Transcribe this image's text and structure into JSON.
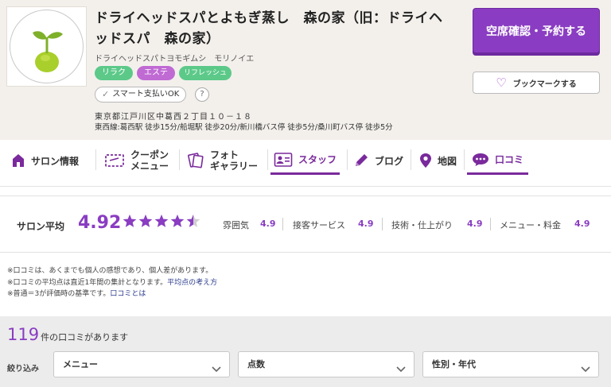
{
  "salon": {
    "title": "ドライヘッドスパとよもぎ蒸し　森の家（旧：ドライヘッドスパ　森の家）",
    "title_line1": "ドライヘッドスパとよもぎ蒸し　森の家（旧：ドライヘ",
    "title_line2": "ッドスパ　森の家）",
    "kana": "ドライヘッドスパトヨモギムシ　モリノイエ",
    "tags": [
      "リラク",
      "エステ",
      "リフレッシュ"
    ],
    "smart_pay": "スマート支払いOK",
    "help_mark": "?",
    "address": "東京都江戸川区中葛西２丁目１０－１８",
    "access": "東西線:葛西駅 徒歩15分/船堀駅 徒歩20分/新川橋バス停 徒歩5分/桑川町バス停 徒歩5分"
  },
  "actions": {
    "reserve_label": "空席確認・予約する",
    "bookmark_label": "ブックマークする"
  },
  "nav": {
    "items": [
      {
        "label": "サロン情報",
        "icon": "house-icon"
      },
      {
        "label_line1": "クーポン",
        "label_line2": "メニュー",
        "icon": "coupon-icon"
      },
      {
        "label_line1": "フォト",
        "label_line2": "ギャラリー",
        "icon": "photo-icon"
      },
      {
        "label": "スタッフ",
        "icon": "staff-card-icon",
        "active": true
      },
      {
        "label": "ブログ",
        "icon": "pen-icon"
      },
      {
        "label": "地図",
        "icon": "map-pin-icon"
      },
      {
        "label": "口コミ",
        "icon": "speech-bubble-icon",
        "active": true
      }
    ]
  },
  "rating": {
    "avg_label": "サロン平均",
    "avg_value": "4.92",
    "stars": 4.92,
    "categories": [
      {
        "label": "雰囲気",
        "value": "4.9"
      },
      {
        "label": "接客サービス",
        "value": "4.9"
      },
      {
        "label": "技術・仕上がり",
        "value": "4.9"
      },
      {
        "label": "メニュー・料金",
        "value": "4.9"
      }
    ]
  },
  "notes": {
    "line1": "※口コミは、あくまでも個人の感想であり、個人差があります。",
    "line2_prefix": "※口コミの平均点は直近1年間の集計となります。",
    "line2_link": "平均点の考え方",
    "line3_prefix": "※普通＝3が評価時の基準です。",
    "line3_link": "口コミとは"
  },
  "reviews": {
    "count": "119",
    "count_suffix": "件の口コミがあります",
    "filter_label": "絞り込み",
    "filters": [
      "メニュー",
      "点数",
      "性別・年代"
    ]
  },
  "colors": {
    "brand_purple": "#8a3dc2",
    "tag_green": "#5cc989",
    "tag_pink": "#c06ad3",
    "header_bg": "#f3f0ec"
  }
}
